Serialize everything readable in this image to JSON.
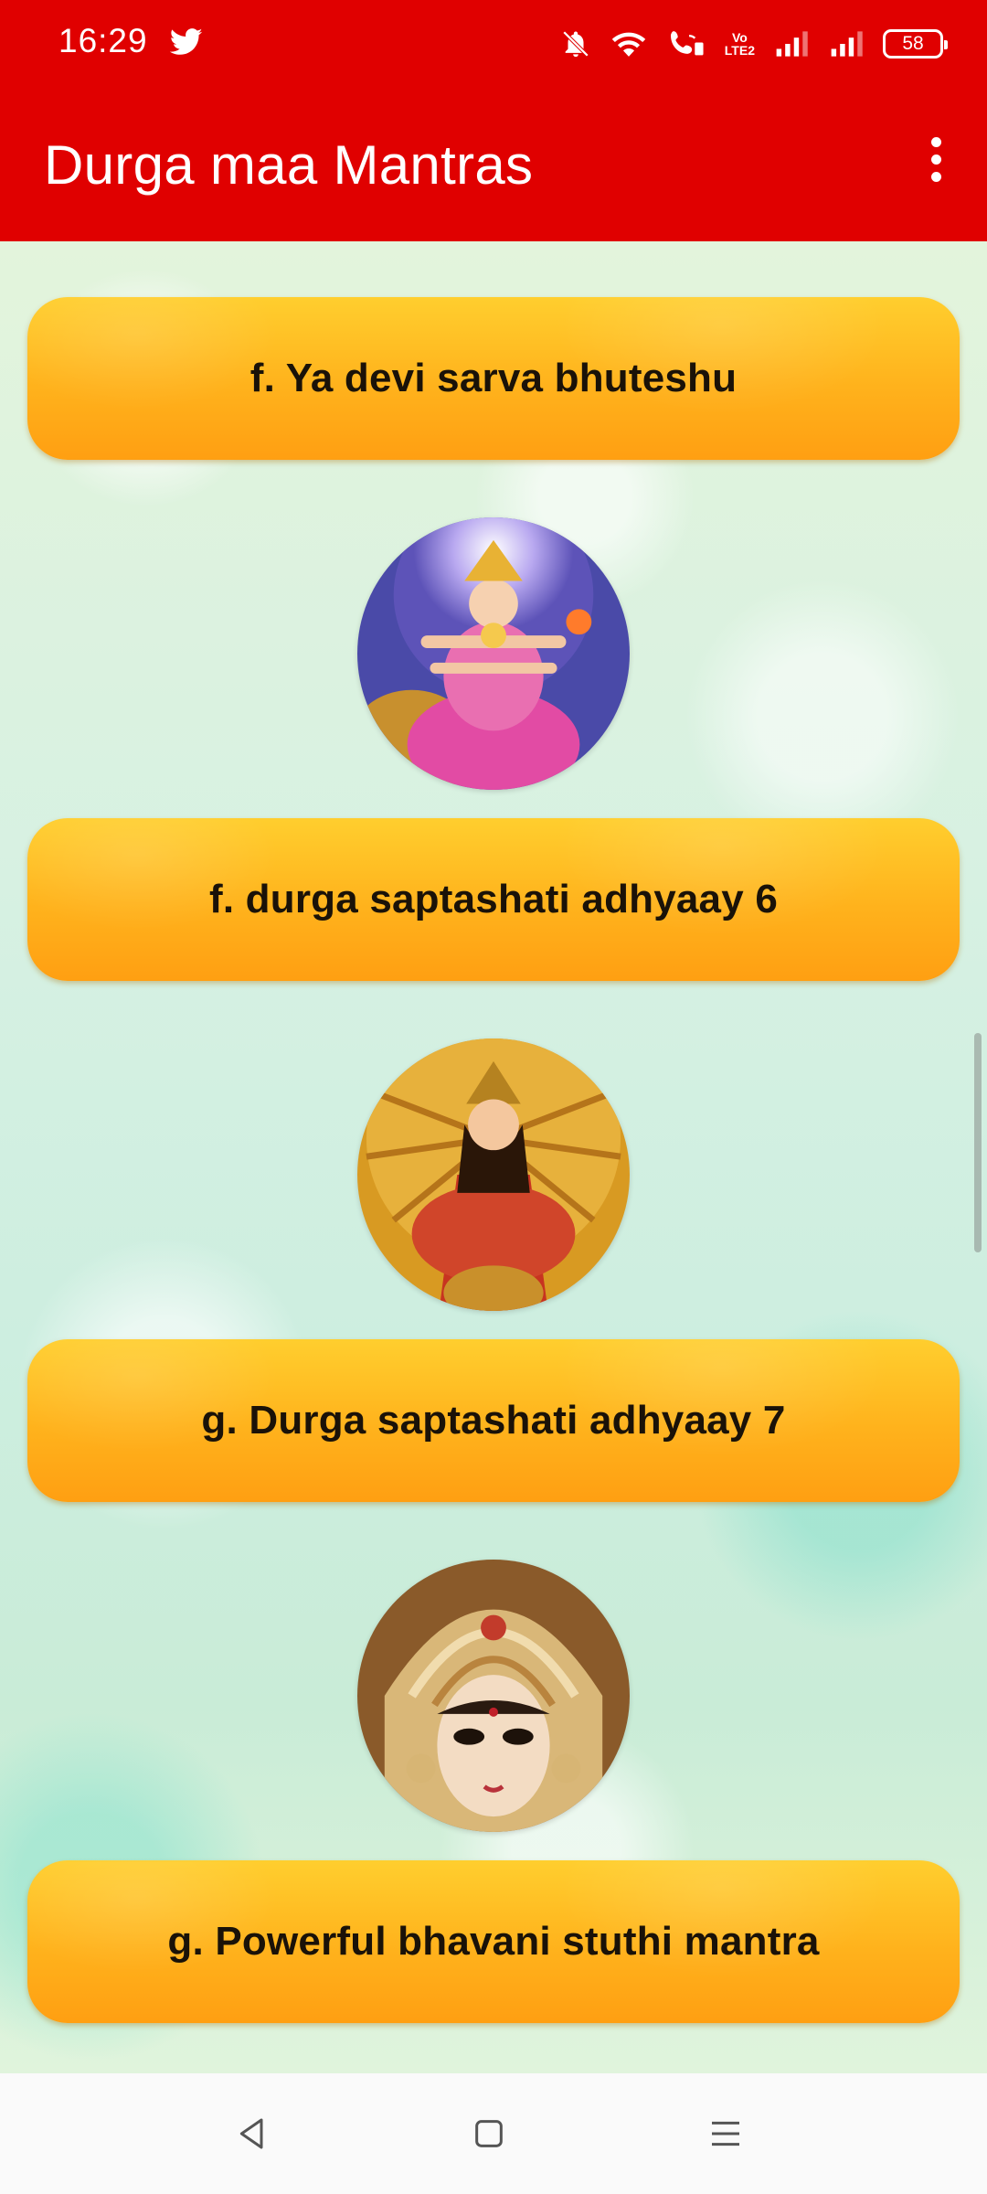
{
  "status_bar": {
    "time": "16:29",
    "volte_label_top": "Vo",
    "volte_label_bottom": "LTE2",
    "battery_level": "58",
    "icons": [
      "twitter-icon",
      "mute-icon",
      "wifi-icon",
      "wifi-calling-icon",
      "volte-icon",
      "signal-icon",
      "signal-icon",
      "battery-icon"
    ]
  },
  "app_bar": {
    "title": "Durga maa Mantras",
    "menu_icon": "overflow-menu-icon"
  },
  "mantras": [
    {
      "label": "f. Ya devi sarva bhuteshu",
      "image": "durga-image"
    },
    {
      "label": "f. durga saptashati adhyaay 6",
      "image": "durga-image"
    },
    {
      "label": "g. Durga saptashati adhyaay 7",
      "image": "durga-image"
    },
    {
      "label": "g. Powerful bhavani stuthi mantra",
      "image": null
    }
  ],
  "nav_bar": {
    "icons": [
      "back-icon",
      "home-icon",
      "menu-icon"
    ]
  },
  "colors": {
    "app_bar": "#e00000",
    "button_top": "#ffce2e",
    "button_bottom": "#ff9f12",
    "button_text": "#1a1208"
  }
}
